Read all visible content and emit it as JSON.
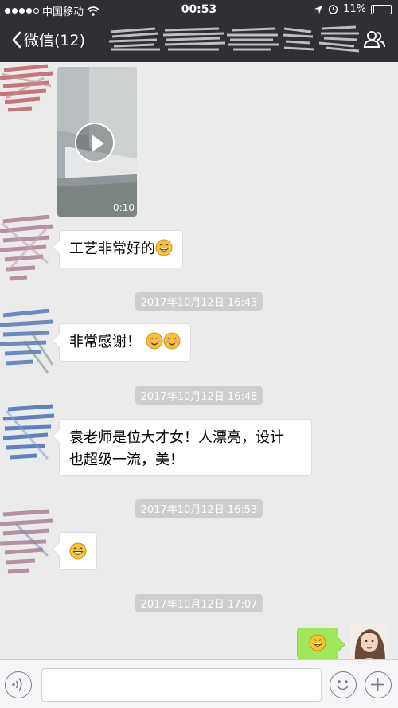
{
  "status_bar": {
    "carrier": "中国移动",
    "time": "00:53",
    "battery": "11%",
    "battery_level": 0.11
  },
  "nav": {
    "back_label": "微信(12)",
    "back_icon": "chevron-left-icon",
    "contacts_icon": "group-contacts-icon"
  },
  "messages": {
    "video_duration": "0:10",
    "msg1": "工艺非常好的",
    "ts1": "2017年10月12日 16:43",
    "msg2": "非常感谢！",
    "ts2": "2017年10月12日 16:48",
    "msg3_line1": "袁老师是位大才女！人漂亮，设计",
    "msg3_line2": "也超级一流，美！",
    "ts3": "2017年10月12日 16:53",
    "ts4": "2017年10月12日 17:07"
  },
  "input_bar": {
    "voice_icon": "voice-icon",
    "emoji_icon": "emoji-icon",
    "plus_icon": "plus-icon"
  },
  "colors": {
    "nav_bg": "#2f2f35",
    "chat_bg": "#ebebeb",
    "my_bubble": "#a0e75a"
  }
}
